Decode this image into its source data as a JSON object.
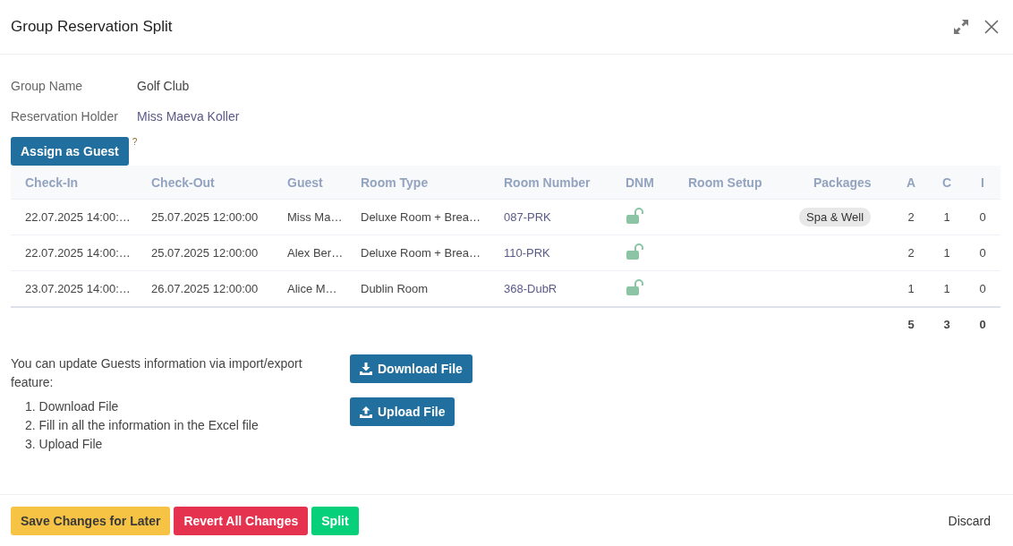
{
  "window": {
    "title": "Group Reservation Split"
  },
  "fields": [
    {
      "label": "Group Name",
      "value": "Golf Club",
      "kind": "plain"
    },
    {
      "label": "Reservation Holder",
      "value": "Miss Maeva Koller",
      "kind": "link"
    }
  ],
  "assign_button": {
    "label": "Assign as Guest",
    "help": "?"
  },
  "table": {
    "columns": [
      "Check-In",
      "Check-Out",
      "Guest",
      "Room Type",
      "Room Number",
      "DNM",
      "Room Setup",
      "Packages",
      "A",
      "C",
      "I"
    ],
    "rows": [
      {
        "check_in": "22.07.2025 14:00:…",
        "check_out": "25.07.2025 12:00:00",
        "guest": "Miss Ma…",
        "room_type": "Deluxe Room + Brea…",
        "room_number": "087-PRK",
        "dnm_locked": false,
        "packages": [
          "Spa & Well"
        ],
        "a": "2",
        "c": "1",
        "i": "0"
      },
      {
        "check_in": "22.07.2025 14:00:…",
        "check_out": "25.07.2025 12:00:00",
        "guest": "Alex Ber…",
        "room_type": "Deluxe Room + Brea…",
        "room_number": "110-PRK",
        "dnm_locked": false,
        "packages": [],
        "a": "2",
        "c": "1",
        "i": "0"
      },
      {
        "check_in": "23.07.2025 14:00:…",
        "check_out": "26.07.2025 12:00:00",
        "guest": "Alice M…",
        "room_type": "Dublin Room",
        "room_number": "368-DubR",
        "dnm_locked": false,
        "packages": [],
        "a": "1",
        "c": "1",
        "i": "0"
      }
    ],
    "totals": {
      "a": "5",
      "c": "3",
      "i": "0"
    }
  },
  "import_export": {
    "text": "You can update Guests information via import/export feature:",
    "steps": [
      "1. Download File",
      "2. Fill in all the information in the Excel file",
      "3. Upload File"
    ],
    "buttons": [
      {
        "label": "Download File",
        "kind": "download"
      },
      {
        "label": "Upload File",
        "kind": "upload"
      }
    ]
  },
  "footer": {
    "buttons": [
      {
        "label": "Save Changes for Later",
        "kind": "warning"
      },
      {
        "label": "Revert All Changes",
        "kind": "danger"
      },
      {
        "label": "Split",
        "kind": "success"
      }
    ],
    "discard": "Discard"
  }
}
